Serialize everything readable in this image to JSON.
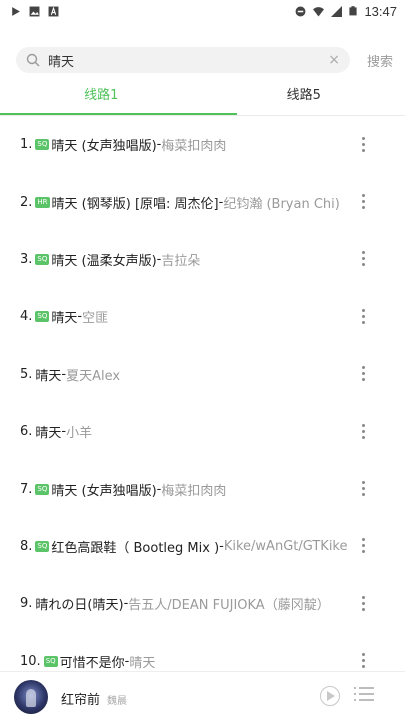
{
  "status_bar": {
    "time": "13:47"
  },
  "search": {
    "query": "晴天",
    "action_label": "搜索"
  },
  "tabs": [
    {
      "label": "线路1",
      "active": true
    },
    {
      "label": "线路5",
      "active": false
    }
  ],
  "songs": [
    {
      "num": "1.",
      "badge": "SQ",
      "title": "晴天 (女声独唱版)",
      "artist": "梅菜扣肉肉"
    },
    {
      "num": "2.",
      "badge": "HR",
      "title": "晴天 (钢琴版) [原唱: 周杰伦]",
      "artist": "纪钧瀚 (Bryan Chi)"
    },
    {
      "num": "3.",
      "badge": "SQ",
      "title": "晴天 (温柔女声版)",
      "artist": "吉拉朵"
    },
    {
      "num": "4.",
      "badge": "SQ",
      "title": "晴天",
      "artist": "空匪"
    },
    {
      "num": "5.",
      "badge": "",
      "title": "晴天",
      "artist": "夏天Alex"
    },
    {
      "num": "6.",
      "badge": "",
      "title": "晴天",
      "artist": "小羊"
    },
    {
      "num": "7.",
      "badge": "SQ",
      "title": "晴天 (女声独唱版)",
      "artist": "梅菜扣肉肉"
    },
    {
      "num": "8.",
      "badge": "SQ",
      "title": "红色高跟鞋（ Bootleg Mix )",
      "artist": "Kike/wAnGt/GTKike"
    },
    {
      "num": "9.",
      "badge": "",
      "title": "晴れの日(晴天)",
      "artist": "告五人/DEAN FUJIOKA（藤冈靛）"
    },
    {
      "num": "10.",
      "badge": "SQ",
      "title": "可惜不是你",
      "artist": "晴天"
    }
  ],
  "player": {
    "title": "红帘前",
    "artist": "魏晨"
  },
  "colors": {
    "accent": "#4fc25a",
    "badge": "#5cc468",
    "artist_text": "#9a9a9a"
  }
}
